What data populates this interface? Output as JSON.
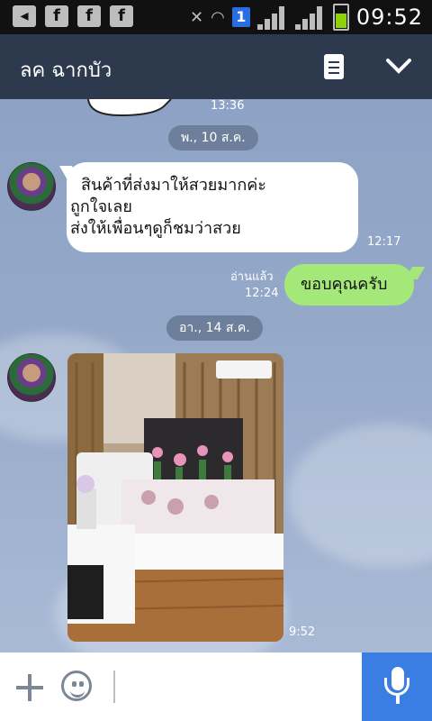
{
  "status_bar": {
    "time": "09:52",
    "sim_badge": "1"
  },
  "header": {
    "title": "ลค ฉากบัว"
  },
  "chat": {
    "top_time": "13:36",
    "date_1": "พ., 10 ส.ค.",
    "msg_in_1": {
      "lines": [
        "สินค้าที่ส่งมาให้สวยมากค่ะ",
        "ถูกใจเลย",
        "ส่งให้เพื่อนๆดูก็ชมว่าสวย"
      ],
      "time": "12:17"
    },
    "msg_out_1": {
      "text": "ขอบคุณครับ",
      "read": "อ่านแล้ว",
      "time": "12:24"
    },
    "date_2": "อา., 14 ส.ค.",
    "photo_msg": {
      "time": "9:52"
    }
  },
  "icons": [
    "back-icon",
    "facebook-icon",
    "notes-icon",
    "chevron-down-icon",
    "plus-icon",
    "emoji-icon",
    "microphone-icon"
  ],
  "colors": {
    "header": "#2d3a4d",
    "outgoing_bubble": "#a5e87a",
    "mic_button": "#3a7de3"
  }
}
